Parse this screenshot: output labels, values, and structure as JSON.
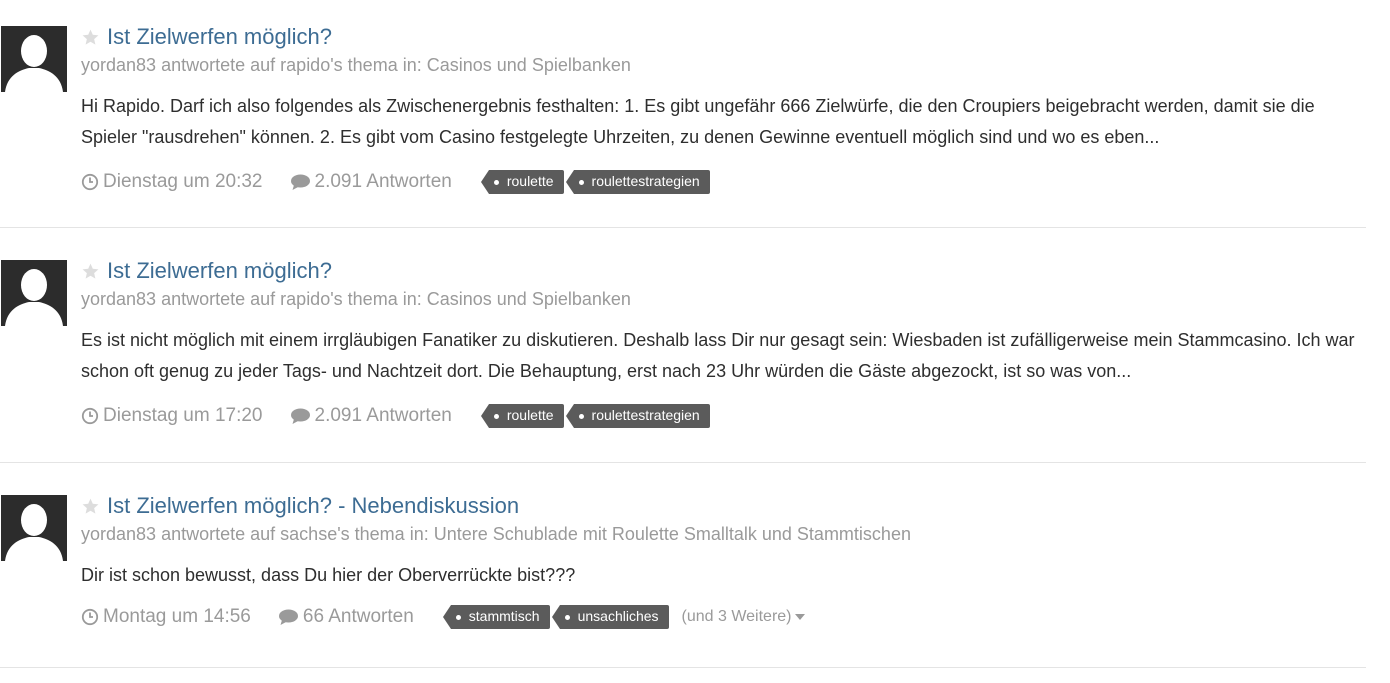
{
  "colors": {
    "title_link": "#3d6c93",
    "muted": "#9a9a9a",
    "tag_bg": "#5b5b5b",
    "avatar_bg": "#2c2c2c"
  },
  "entries": [
    {
      "title": "Ist Zielwerfen möglich?",
      "author": "yordan83",
      "action": "antwortete auf",
      "topic_owner": "rapido's",
      "topic_word": "thema",
      "in_label": "in:",
      "forum": "Casinos und Spielbanken",
      "snippet": "Hi Rapido. Darf ich also folgendes als Zwischenergebnis festhalten: 1. Es gibt ungefähr 666 Zielwürfe, die den Croupiers beigebracht werden, damit sie die Spieler \"rausdrehen\" können. 2. Es gibt vom Casino festgelegte Uhrzeiten, zu denen Gewinne eventuell möglich sind und wo es eben...",
      "date": "Dienstag um 20:32",
      "replies": "2.091 Antworten",
      "tags": [
        "roulette",
        "roulettestrategien"
      ],
      "more": ""
    },
    {
      "title": "Ist Zielwerfen möglich?",
      "author": "yordan83",
      "action": "antwortete auf",
      "topic_owner": "rapido's",
      "topic_word": "thema",
      "in_label": "in:",
      "forum": "Casinos und Spielbanken",
      "snippet": "Es ist nicht möglich mit einem irrgläubigen Fanatiker zu diskutieren. Deshalb lass Dir nur gesagt sein: Wiesbaden ist zufälligerweise mein Stammca­sino. Ich war schon oft genug zu jeder Tags- und Nachtzeit dort. Die Behauptung, erst nach 23 Uhr würden die Gäste abgezockt, ist so was von...",
      "date": "Dienstag um 17:20",
      "replies": "2.091 Antworten",
      "tags": [
        "roulette",
        "roulettestrategien"
      ],
      "more": ""
    },
    {
      "title": "Ist Zielwerfen möglich? - Nebendiskussion",
      "author": "yordan83",
      "action": "antwortete auf",
      "topic_owner": "sachse's",
      "topic_word": "thema",
      "in_label": "in:",
      "forum": "Untere Schublade mit Roulette Smalltalk und Stammtischen",
      "snippet": "Dir ist schon bewusst, dass Du hier der Oberverrückte bist???",
      "date": "Montag um 14:56",
      "replies": "66 Antworten",
      "tags": [
        "stammtisch",
        "unsachliches"
      ],
      "more": "(und 3 Weitere)"
    }
  ]
}
